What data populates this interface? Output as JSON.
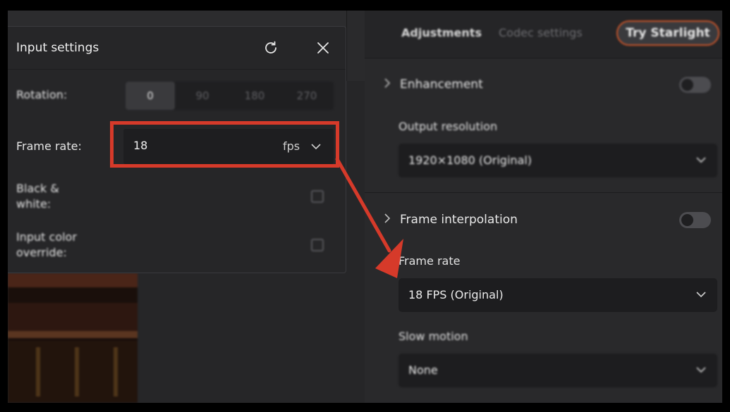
{
  "colors": {
    "highlight": "#d63a2a",
    "accent_outline": "#c7542a"
  },
  "dialog": {
    "title": "Input settings",
    "rotation": {
      "label": "Rotation:",
      "options": [
        "0",
        "90",
        "180",
        "270"
      ],
      "selected": "0"
    },
    "frame_rate": {
      "label": "Frame rate:",
      "value": "18",
      "unit": "fps"
    },
    "black_white": {
      "label_line1": "Black &",
      "label_line2": "white:"
    },
    "color_override": {
      "label_line1": "Input color",
      "label_line2": "override:"
    }
  },
  "panel": {
    "tabs": [
      "Adjustments",
      "Codec settings"
    ],
    "try_button": "Try Starlight",
    "enhancement": {
      "label": "Enhancement"
    },
    "output_resolution": {
      "label": "Output resolution",
      "value": "1920×1080 (Original)"
    },
    "frame_interpolation": {
      "label": "Frame interpolation"
    },
    "frame_rate": {
      "label": "Frame rate",
      "value": "18 FPS (Original)"
    },
    "slow_motion": {
      "label": "Slow motion",
      "value": "None"
    }
  }
}
